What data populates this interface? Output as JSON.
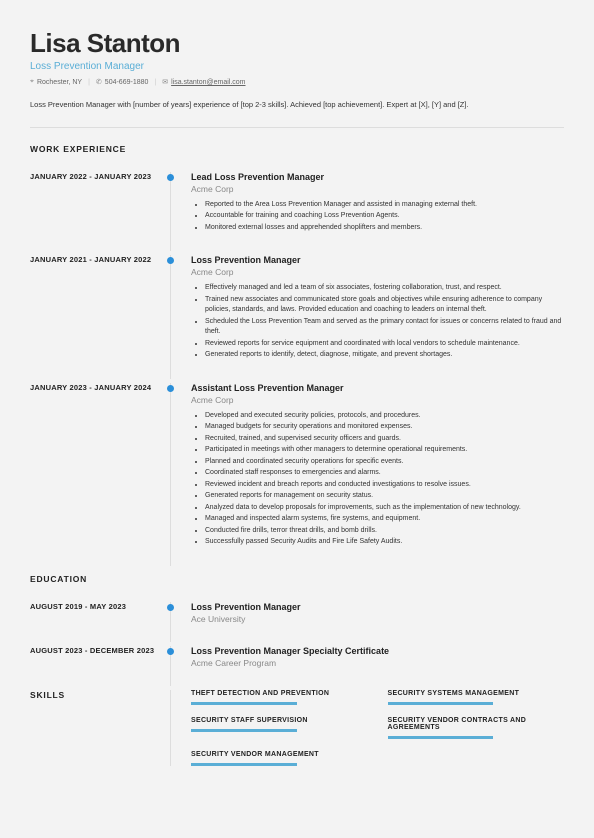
{
  "header": {
    "name": "Lisa Stanton",
    "title": "Loss Prevention Manager",
    "location": "Rochester, NY",
    "phone": "504-669-1880",
    "email": "lisa.stanton@email.com"
  },
  "summary": "Loss Prevention Manager with [number of years] experience of [top 2-3 skills]. Achieved [top achievement]. Expert at [X], [Y] and [Z].",
  "sections": {
    "work_experience_heading": "WORK EXPERIENCE",
    "education_heading": "EDUCATION",
    "skills_heading": "SKILLS"
  },
  "work_experience": [
    {
      "dates": "JANUARY 2022 - JANUARY 2023",
      "title": "Lead Loss Prevention Manager",
      "company": "Acme Corp",
      "bullets": [
        "Reported to the Area Loss Prevention Manager and assisted in managing external theft.",
        "Accountable for training and coaching Loss Prevention Agents.",
        "Monitored external losses and apprehended shoplifters and members."
      ]
    },
    {
      "dates": "JANUARY 2021 - JANUARY 2022",
      "title": "Loss Prevention Manager",
      "company": "Acme Corp",
      "bullets": [
        "Effectively managed and led a team of six associates, fostering collaboration, trust, and respect.",
        "Trained new associates and communicated store goals and objectives while ensuring adherence to company policies, standards, and laws. Provided education and coaching to leaders on internal theft.",
        "Scheduled the Loss Prevention Team and served as the primary contact for issues or concerns related to fraud and theft.",
        "Reviewed reports for service equipment and coordinated with local vendors to schedule maintenance.",
        "Generated reports to identify, detect, diagnose, mitigate, and prevent shortages."
      ]
    },
    {
      "dates": "JANUARY 2023 - JANUARY 2024",
      "title": "Assistant Loss Prevention Manager",
      "company": "Acme Corp",
      "bullets": [
        "Developed and executed security policies, protocols, and procedures.",
        "Managed budgets for security operations and monitored expenses.",
        "Recruited, trained, and supervised security officers and guards.",
        "Participated in meetings with other managers to determine operational requirements.",
        "Planned and coordinated security operations for specific events.",
        "Coordinated staff responses to emergencies and alarms.",
        "Reviewed incident and breach reports and conducted investigations to resolve issues.",
        "Generated reports for management on security status.",
        "Analyzed data to develop proposals for improvements, such as the implementation of new technology.",
        "Managed and inspected alarm systems, fire systems, and equipment.",
        "Conducted fire drills, terror threat drills, and bomb drills.",
        "Successfully passed Security Audits and Fire Life Safety Audits."
      ]
    }
  ],
  "education": [
    {
      "dates": "AUGUST 2019 - MAY 2023",
      "title": "Loss Prevention Manager",
      "company": "Ace University"
    },
    {
      "dates": "AUGUST 2023 - DECEMBER 2023",
      "title": "Loss Prevention Manager Specialty Certificate",
      "company": "Acme Career Program"
    }
  ],
  "skills": [
    "THEFT DETECTION AND PREVENTION",
    "SECURITY SYSTEMS MANAGEMENT",
    "SECURITY STAFF SUPERVISION",
    "SECURITY VENDOR CONTRACTS AND AGREEMENTS",
    "SECURITY VENDOR MANAGEMENT"
  ]
}
